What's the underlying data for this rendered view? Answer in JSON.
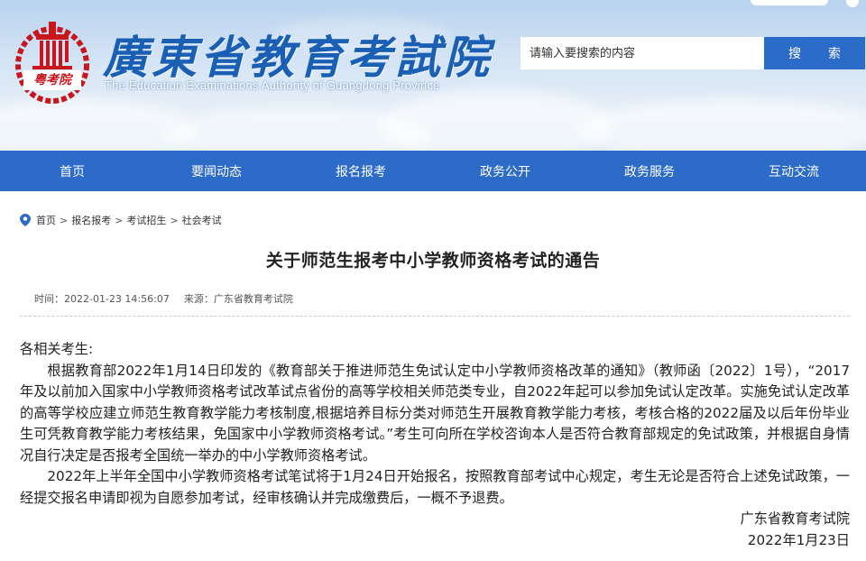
{
  "header": {
    "title": "廣東省教育考試院",
    "subtitle": "The Education Examinations Authority of Guangdong Province",
    "logo_text": "粤考院",
    "search": {
      "placeholder": "请输入要搜索的内容",
      "button_label": "搜　索"
    }
  },
  "nav": {
    "items": [
      {
        "label": "首页"
      },
      {
        "label": "要闻动态"
      },
      {
        "label": "报名报考"
      },
      {
        "label": "政务公开"
      },
      {
        "label": "政务服务"
      },
      {
        "label": "互动交流"
      }
    ]
  },
  "breadcrumb": {
    "items": [
      {
        "label": "首页"
      },
      {
        "label": "报名报考"
      },
      {
        "label": "考试招生"
      },
      {
        "label": "社会考试"
      }
    ],
    "separator": ">"
  },
  "article": {
    "title": "关于师范生报考中小学教师资格考试的通告",
    "time": "时间：2022-01-23 14:56:07",
    "source": "来源：广东省教育考试院",
    "salutation": "各相关考生:",
    "paragraph1": "根据教育部2022年1月14日印发的《教育部关于推进师范生免试认定中小学教师资格改革的通知》（教师函〔2022〕1号），“2017年及以前加入国家中小学教师资格考试改革试点省份的高等学校相关师范类专业，自2022年起可以参加免试认定改革。实施免试认定改革的高等学校应建立师范生教育教学能力考核制度,根据培养目标分类对师范生开展教育教学能力考核，考核合格的2022届及以后年份毕业生可凭教育教学能力考核结果，免国家中小学教师资格考试。”考生可向所在学校咨询本人是否符合教育部规定的免试政策，并根据自身情况自行决定是否报考全国统一举办的中小学教师资格考试。",
    "paragraph2": "2022年上半年全国中小学教师资格考试笔试将于1月24日开始报名，按照教育部考试中心规定，考生无论是否符合上述免试政策，一经提交报名申请即视为自愿参加考试，经审核确认并完成缴费后，一概不予退费。",
    "signature": "广东省教育考试院",
    "date": "2022年1月23日"
  },
  "colors": {
    "brand_blue": "#2d6bc9",
    "title_blue": "#1a5fb4",
    "logo_red": "#c8161d"
  }
}
